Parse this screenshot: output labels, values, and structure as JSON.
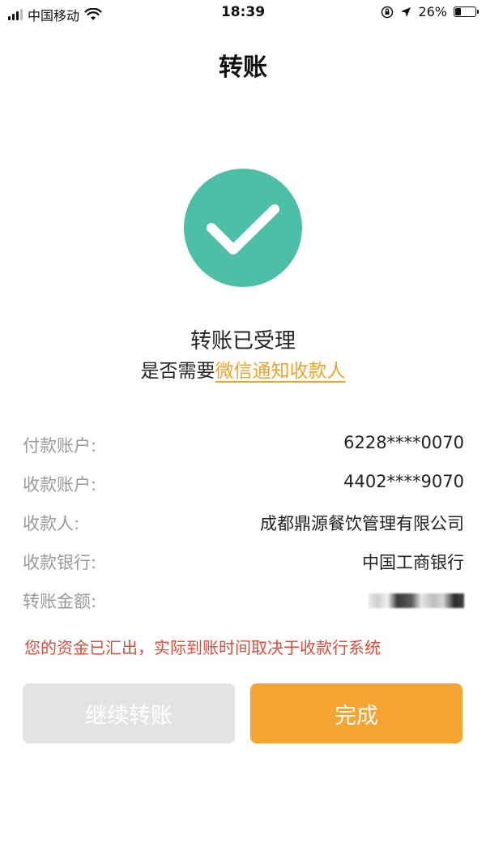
{
  "status_bar": {
    "carrier": "中国移动",
    "time": "18:39",
    "battery": "26%",
    "battery_level": 0.26,
    "icons": [
      "signal-icon",
      "wifi-icon",
      "orientation-lock-icon",
      "location-icon",
      "battery-icon"
    ]
  },
  "nav": {
    "title": "转账"
  },
  "result": {
    "icon": "check-circle-icon",
    "icon_color": "#4cbfa6",
    "title": "转账已受理",
    "notify_prefix": "是否需要",
    "notify_link": "微信通知收款人",
    "link_color": "#f0a32b"
  },
  "details": [
    {
      "label": "付款账户:",
      "value": "6228****0070"
    },
    {
      "label": "收款账户:",
      "value": "4402****9070"
    },
    {
      "label": "收款人:",
      "value": "成都鼎源餐饮管理有限公司"
    },
    {
      "label": "收款银行:",
      "value": "中国工商银行"
    },
    {
      "label": "转账金额:",
      "value": ""
    }
  ],
  "warning": {
    "text": "您的资金已汇出，实际到账时间取决于收款行系统",
    "color": "#e04a3a"
  },
  "buttons": {
    "continue_label": "继续转账",
    "done_label": "完成",
    "done_color": "#f4a531"
  }
}
